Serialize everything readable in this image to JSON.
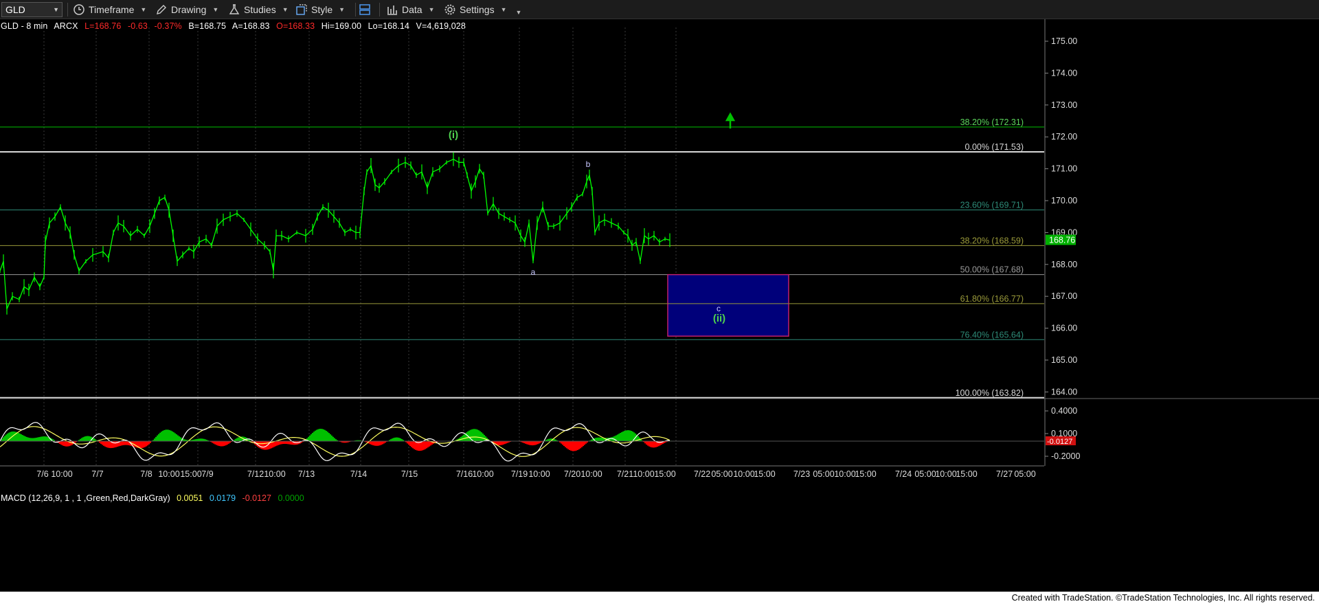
{
  "toolbar": {
    "symbol": "GLD",
    "timeframe_label": "Timeframe",
    "drawing_label": "Drawing",
    "studies_label": "Studies",
    "style_label": "Style",
    "data_label": "Data",
    "settings_label": "Settings"
  },
  "quote": {
    "title": "GLD - 8 min",
    "exchange": "ARCX",
    "last": "L=168.76",
    "change": "-0.63",
    "change_pct": "-0.37%",
    "bid": "B=168.75",
    "ask": "A=168.83",
    "open": "O=168.33",
    "high": "Hi=169.00",
    "low": "Lo=168.14",
    "volume": "V=4,619,028"
  },
  "macd": {
    "label": "MACD (12,26,9, 1 , 1 ,Green,Red,DarkGray)",
    "v1": "0.0051",
    "v2": "0.0179",
    "v3": "-0.0127",
    "v4": "0.0000",
    "axis_labels": [
      "0.4000",
      "0.1000",
      "-0.2000"
    ],
    "current_badge": "-0.0127"
  },
  "price_axis": {
    "labels": [
      "175.00",
      "174.00",
      "173.00",
      "172.00",
      "171.00",
      "170.00",
      "169.00",
      "168.00",
      "167.00",
      "166.00",
      "165.00",
      "164.00"
    ],
    "current_price": "168.76"
  },
  "time_axis": {
    "labels": [
      "7/6",
      "10:00",
      "7/7",
      "7/8",
      "10:00",
      "15:00",
      "7/9",
      "7/12",
      "10:00",
      "7/13",
      "7/14",
      "7/15",
      "7/16",
      "10:00",
      "7/19",
      "10:00",
      "7/20",
      "10:00",
      "7/21",
      "10:00",
      "15:00",
      "7/22",
      "05:00",
      "10:00",
      "15:00",
      "7/23",
      "05:00",
      "10:00",
      "15:00",
      "7/24",
      "05:00",
      "10:00",
      "15:00",
      "7/27",
      "05:00"
    ]
  },
  "fib_levels": [
    {
      "label": "38.20% (172.31)",
      "price": 172.31,
      "color": "#00c000"
    },
    {
      "label": "0.00% (171.53)",
      "price": 171.53,
      "color": "#d8d8d8"
    },
    {
      "label": "23.60% (169.71)",
      "price": 169.71,
      "color": "#2e8b78"
    },
    {
      "label": "38.20% (168.59)",
      "price": 168.59,
      "color": "#9a9a3a"
    },
    {
      "label": "50.00% (167.68)",
      "price": 167.68,
      "color": "#9a9a9a"
    },
    {
      "label": "61.80% (166.77)",
      "price": 166.77,
      "color": "#9a9a3a"
    },
    {
      "label": "76.40% (165.64)",
      "price": 165.64,
      "color": "#2e8b78"
    },
    {
      "label": "100.00% (163.82)",
      "price": 163.82,
      "color": "#d8d8d8"
    }
  ],
  "annotations": {
    "wave_i": "(i)",
    "wave_ii": "(ii)",
    "a": "a",
    "b": "b",
    "c": "c"
  },
  "target_box": {
    "price_top": 167.68,
    "price_bottom": 165.75,
    "fill": "#00007a",
    "border": "#c0206a"
  },
  "colors": {
    "price_line": "#00ff00",
    "macd_hist_pos": "#00c000",
    "macd_hist_neg": "#ff0000",
    "macd_line": "#ffffff",
    "signal_line": "#ffff60",
    "current_price_badge": "#00b000"
  },
  "chart_data": {
    "type": "line",
    "title": "GLD - 8 min",
    "ylim": [
      163.7,
      175.6
    ],
    "xlabel": "",
    "ylabel": "",
    "series": [
      {
        "name": "GLD",
        "points": [
          [
            0,
            167.8
          ],
          [
            5,
            168.1
          ],
          [
            10,
            166.6
          ],
          [
            18,
            167.0
          ],
          [
            28,
            166.9
          ],
          [
            35,
            167.3
          ],
          [
            42,
            167.2
          ],
          [
            50,
            167.6
          ],
          [
            58,
            167.3
          ],
          [
            64,
            167.6
          ],
          [
            66,
            168.7
          ],
          [
            72,
            169.3
          ],
          [
            80,
            169.5
          ],
          [
            88,
            169.8
          ],
          [
            95,
            169.3
          ],
          [
            102,
            169.0
          ],
          [
            108,
            168.3
          ],
          [
            115,
            167.8
          ],
          [
            125,
            168.1
          ],
          [
            135,
            168.3
          ],
          [
            150,
            168.4
          ],
          [
            158,
            168.2
          ],
          [
            165,
            169.0
          ],
          [
            172,
            169.3
          ],
          [
            180,
            169.2
          ],
          [
            190,
            168.9
          ],
          [
            200,
            169.1
          ],
          [
            210,
            168.9
          ],
          [
            218,
            169.2
          ],
          [
            225,
            169.6
          ],
          [
            232,
            170.0
          ],
          [
            240,
            170.1
          ],
          [
            246,
            169.7
          ],
          [
            252,
            168.9
          ],
          [
            258,
            168.1
          ],
          [
            266,
            168.3
          ],
          [
            275,
            168.5
          ],
          [
            282,
            168.4
          ],
          [
            290,
            168.7
          ],
          [
            300,
            168.8
          ],
          [
            308,
            168.6
          ],
          [
            316,
            169.2
          ],
          [
            325,
            169.4
          ],
          [
            335,
            169.5
          ],
          [
            345,
            169.6
          ],
          [
            355,
            169.4
          ],
          [
            365,
            169.1
          ],
          [
            375,
            168.8
          ],
          [
            385,
            168.6
          ],
          [
            393,
            168.4
          ],
          [
            398,
            167.8
          ],
          [
            402,
            168.9
          ],
          [
            410,
            168.9
          ],
          [
            420,
            168.8
          ],
          [
            432,
            169.0
          ],
          [
            445,
            168.9
          ],
          [
            455,
            169.1
          ],
          [
            462,
            169.5
          ],
          [
            470,
            169.8
          ],
          [
            478,
            169.7
          ],
          [
            486,
            169.5
          ],
          [
            494,
            169.3
          ],
          [
            502,
            169.0
          ],
          [
            510,
            169.1
          ],
          [
            518,
            169.0
          ],
          [
            524,
            169.0
          ],
          [
            530,
            170.3
          ],
          [
            534,
            170.9
          ],
          [
            540,
            171.1
          ],
          [
            546,
            170.5
          ],
          [
            552,
            170.4
          ],
          [
            560,
            170.6
          ],
          [
            570,
            170.9
          ],
          [
            580,
            171.1
          ],
          [
            590,
            171.2
          ],
          [
            598,
            171.1
          ],
          [
            606,
            170.8
          ],
          [
            614,
            170.9
          ],
          [
            622,
            170.4
          ],
          [
            630,
            170.9
          ],
          [
            640,
            171.0
          ],
          [
            650,
            171.2
          ],
          [
            660,
            171.3
          ],
          [
            668,
            171.2
          ],
          [
            675,
            171.2
          ],
          [
            680,
            170.8
          ],
          [
            686,
            170.3
          ],
          [
            692,
            170.6
          ],
          [
            698,
            171.0
          ],
          [
            704,
            170.8
          ],
          [
            710,
            169.6
          ],
          [
            718,
            169.9
          ],
          [
            726,
            169.6
          ],
          [
            734,
            169.5
          ],
          [
            742,
            169.4
          ],
          [
            750,
            169.3
          ],
          [
            758,
            168.9
          ],
          [
            764,
            168.7
          ],
          [
            770,
            169.3
          ],
          [
            776,
            168.1
          ],
          [
            782,
            169.3
          ],
          [
            790,
            169.8
          ],
          [
            798,
            169.2
          ],
          [
            806,
            169.2
          ],
          [
            815,
            169.3
          ],
          [
            825,
            169.6
          ],
          [
            832,
            169.8
          ],
          [
            840,
            170.1
          ],
          [
            848,
            170.2
          ],
          [
            854,
            170.6
          ],
          [
            858,
            170.8
          ],
          [
            862,
            170.3
          ],
          [
            866,
            169.0
          ],
          [
            872,
            169.3
          ],
          [
            880,
            169.4
          ],
          [
            890,
            169.3
          ],
          [
            900,
            169.2
          ],
          [
            908,
            169.0
          ],
          [
            914,
            168.9
          ],
          [
            920,
            168.6
          ],
          [
            926,
            168.7
          ],
          [
            932,
            168.1
          ],
          [
            938,
            168.9
          ],
          [
            944,
            168.8
          ],
          [
            952,
            168.9
          ],
          [
            960,
            168.7
          ],
          [
            968,
            168.8
          ],
          [
            975,
            168.76
          ]
        ]
      }
    ]
  }
}
